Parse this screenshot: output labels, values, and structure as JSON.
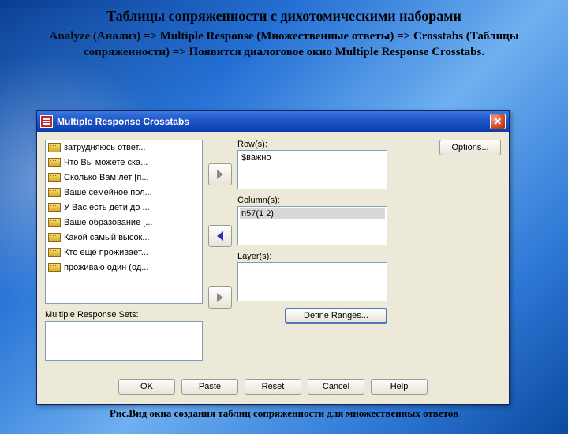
{
  "slide": {
    "title": "Таблицы сопряженности с дихотомическими наборами",
    "subtitle": "Analyze (Анализ) => Multiple Response (Множественные ответы) => Crosstabs (Таблицы сопряженности) => Появится диалоговое окно Multiple Response Crosstabs.",
    "caption": "Рис.Вид окна создания таблиц сопряженности для множественных ответов"
  },
  "dialog": {
    "title": "Multiple Response Crosstabs",
    "varlist": [
      "затрудняюсь ответ...",
      "Что Вы можете ска...",
      "Сколько Вам лет [п...",
      "Ваше семейное пол...",
      "У Вас есть дети до ...",
      "Ваше образование [...",
      "Какой самый высок...",
      "Кто еще проживает...",
      "проживаю один (од..."
    ],
    "mrs_label": "Multiple Response Sets:",
    "rows_label": "Row(s):",
    "rows_item": "$важно",
    "cols_label": "Column(s):",
    "cols_item": "n57(1 2)",
    "layers_label": "Layer(s):",
    "options_label": "Options...",
    "define_label": "Define Ranges...",
    "buttons": {
      "ok": "OK",
      "paste": "Paste",
      "reset": "Reset",
      "cancel": "Cancel",
      "help": "Help"
    }
  }
}
